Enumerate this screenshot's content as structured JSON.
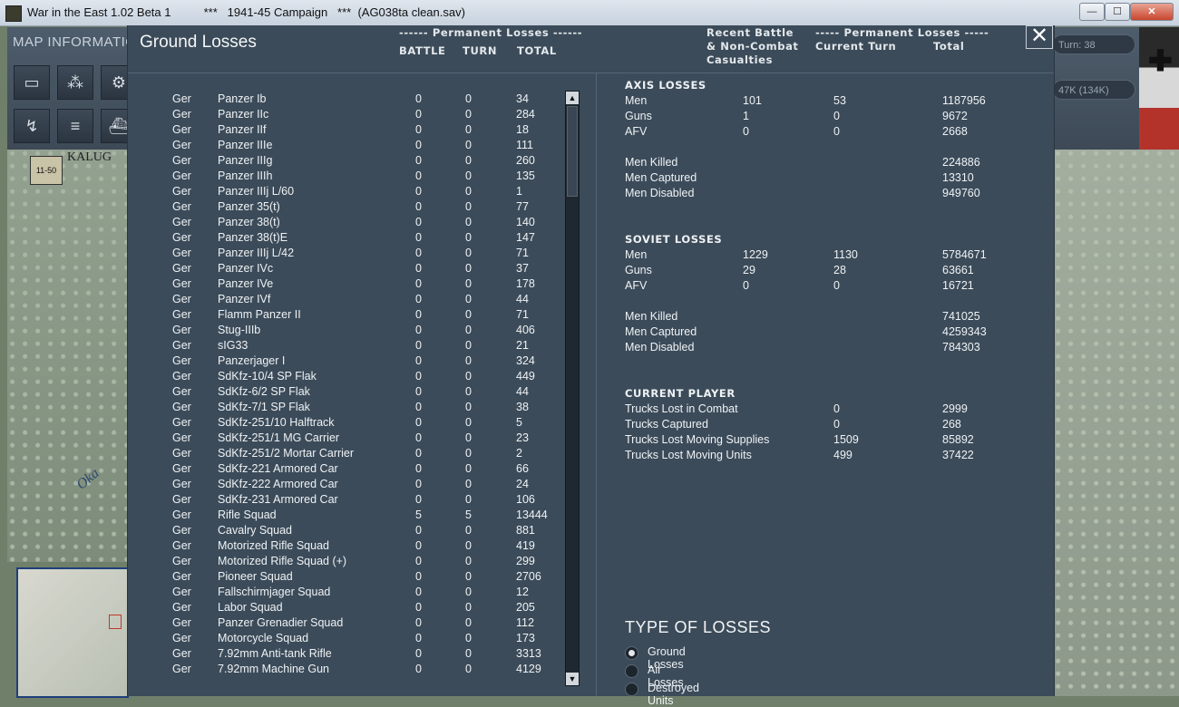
{
  "window": {
    "title": "War in the East 1.02 Beta 1          ***   1941-45 Campaign   ***  (AG038ta clean.sav)",
    "min_label": "—",
    "max_label": "☐",
    "close_label": "✕"
  },
  "background": {
    "map_info_label": "MAP INFORMATIO",
    "map_label_city": "KALUG",
    "map_label_river": "Oka",
    "counter_label": "11-50",
    "turn_pill": "Turn: 38",
    "loss_pill": "47K (134K)"
  },
  "dialog": {
    "title": "Ground Losses",
    "close_label": "✕",
    "header_perm_left": "------ Permanent Losses ------",
    "col_battle": "BATTLE",
    "col_turn": "TURN",
    "col_total": "TOTAL",
    "header_recent_1": "Recent Battle",
    "header_recent_2": "& Non-Combat",
    "header_recent_3": "Casualties",
    "header_perm_right": "----- Permanent Losses -----",
    "col_current_turn": "Current Turn",
    "col_total_right": "Total"
  },
  "equipment_rows": [
    {
      "nat": "Ger",
      "name": "Panzer Ib",
      "battle": "0",
      "turn": "0",
      "total": "34"
    },
    {
      "nat": "Ger",
      "name": "Panzer IIc",
      "battle": "0",
      "turn": "0",
      "total": "284"
    },
    {
      "nat": "Ger",
      "name": "Panzer IIf",
      "battle": "0",
      "turn": "0",
      "total": "18"
    },
    {
      "nat": "Ger",
      "name": "Panzer IIIe",
      "battle": "0",
      "turn": "0",
      "total": "111"
    },
    {
      "nat": "Ger",
      "name": "Panzer IIIg",
      "battle": "0",
      "turn": "0",
      "total": "260"
    },
    {
      "nat": "Ger",
      "name": "Panzer IIIh",
      "battle": "0",
      "turn": "0",
      "total": "135"
    },
    {
      "nat": "Ger",
      "name": "Panzer IIIj L/60",
      "battle": "0",
      "turn": "0",
      "total": "1"
    },
    {
      "nat": "Ger",
      "name": "Panzer 35(t)",
      "battle": "0",
      "turn": "0",
      "total": "77"
    },
    {
      "nat": "Ger",
      "name": "Panzer 38(t)",
      "battle": "0",
      "turn": "0",
      "total": "140"
    },
    {
      "nat": "Ger",
      "name": "Panzer 38(t)E",
      "battle": "0",
      "turn": "0",
      "total": "147"
    },
    {
      "nat": "Ger",
      "name": "Panzer IIIj L/42",
      "battle": "0",
      "turn": "0",
      "total": "71"
    },
    {
      "nat": "Ger",
      "name": "Panzer IVc",
      "battle": "0",
      "turn": "0",
      "total": "37"
    },
    {
      "nat": "Ger",
      "name": "Panzer IVe",
      "battle": "0",
      "turn": "0",
      "total": "178"
    },
    {
      "nat": "Ger",
      "name": "Panzer IVf",
      "battle": "0",
      "turn": "0",
      "total": "44"
    },
    {
      "nat": "Ger",
      "name": "Flamm Panzer II",
      "battle": "0",
      "turn": "0",
      "total": "71"
    },
    {
      "nat": "Ger",
      "name": "Stug-IIIb",
      "battle": "0",
      "turn": "0",
      "total": "406"
    },
    {
      "nat": "Ger",
      "name": "sIG33",
      "battle": "0",
      "turn": "0",
      "total": "21"
    },
    {
      "nat": "Ger",
      "name": "Panzerjager I",
      "battle": "0",
      "turn": "0",
      "total": "324"
    },
    {
      "nat": "Ger",
      "name": "SdKfz-10/4 SP Flak",
      "battle": "0",
      "turn": "0",
      "total": "449"
    },
    {
      "nat": "Ger",
      "name": "SdKfz-6/2 SP Flak",
      "battle": "0",
      "turn": "0",
      "total": "44"
    },
    {
      "nat": "Ger",
      "name": "SdKfz-7/1 SP Flak",
      "battle": "0",
      "turn": "0",
      "total": "38"
    },
    {
      "nat": "Ger",
      "name": "SdKfz-251/10 Halftrack",
      "battle": "0",
      "turn": "0",
      "total": "5"
    },
    {
      "nat": "Ger",
      "name": "SdKfz-251/1 MG Carrier",
      "battle": "0",
      "turn": "0",
      "total": "23"
    },
    {
      "nat": "Ger",
      "name": "SdKfz-251/2 Mortar Carrier",
      "battle": "0",
      "turn": "0",
      "total": "2"
    },
    {
      "nat": "Ger",
      "name": "SdKfz-221 Armored Car",
      "battle": "0",
      "turn": "0",
      "total": "66"
    },
    {
      "nat": "Ger",
      "name": "SdKfz-222 Armored Car",
      "battle": "0",
      "turn": "0",
      "total": "24"
    },
    {
      "nat": "Ger",
      "name": "SdKfz-231 Armored Car",
      "battle": "0",
      "turn": "0",
      "total": "106"
    },
    {
      "nat": "Ger",
      "name": "Rifle Squad",
      "battle": "5",
      "turn": "5",
      "total": "13444"
    },
    {
      "nat": "Ger",
      "name": "Cavalry Squad",
      "battle": "0",
      "turn": "0",
      "total": "881"
    },
    {
      "nat": "Ger",
      "name": "Motorized Rifle Squad",
      "battle": "0",
      "turn": "0",
      "total": "419"
    },
    {
      "nat": "Ger",
      "name": "Motorized Rifle Squad (+)",
      "battle": "0",
      "turn": "0",
      "total": "299"
    },
    {
      "nat": "Ger",
      "name": "Pioneer Squad",
      "battle": "0",
      "turn": "0",
      "total": "2706"
    },
    {
      "nat": "Ger",
      "name": "Fallschirmjager Squad",
      "battle": "0",
      "turn": "0",
      "total": "12"
    },
    {
      "nat": "Ger",
      "name": "Labor Squad",
      "battle": "0",
      "turn": "0",
      "total": "205"
    },
    {
      "nat": "Ger",
      "name": "Panzer Grenadier Squad",
      "battle": "0",
      "turn": "0",
      "total": "112"
    },
    {
      "nat": "Ger",
      "name": "Motorcycle Squad",
      "battle": "0",
      "turn": "0",
      "total": "173"
    },
    {
      "nat": "Ger",
      "name": "7.92mm Anti-tank Rifle",
      "battle": "0",
      "turn": "0",
      "total": "3313"
    },
    {
      "nat": "Ger",
      "name": "7.92mm Machine Gun",
      "battle": "0",
      "turn": "0",
      "total": "4129"
    }
  ],
  "axis": {
    "heading": "AXIS LOSSES",
    "rows": [
      {
        "label": "Men",
        "recent": "101",
        "turn": "53",
        "total": "1187956"
      },
      {
        "label": "Guns",
        "recent": "1",
        "turn": "0",
        "total": "9672"
      },
      {
        "label": "AFV",
        "recent": "0",
        "turn": "0",
        "total": "2668"
      }
    ],
    "breakdown": [
      {
        "label": "Men Killed",
        "total": "224886"
      },
      {
        "label": "Men Captured",
        "total": "13310"
      },
      {
        "label": "Men Disabled",
        "total": "949760"
      }
    ]
  },
  "soviet": {
    "heading": "SOVIET LOSSES",
    "rows": [
      {
        "label": "Men",
        "recent": "1229",
        "turn": "1130",
        "total": "5784671"
      },
      {
        "label": "Guns",
        "recent": "29",
        "turn": "28",
        "total": "63661"
      },
      {
        "label": "AFV",
        "recent": "0",
        "turn": "0",
        "total": "16721"
      }
    ],
    "breakdown": [
      {
        "label": "Men Killed",
        "total": "741025"
      },
      {
        "label": "Men Captured",
        "total": "4259343"
      },
      {
        "label": "Men Disabled",
        "total": "784303"
      }
    ]
  },
  "current_player": {
    "heading": "CURRENT PLAYER",
    "rows": [
      {
        "label": "Trucks Lost in Combat",
        "turn": "0",
        "total": "2999"
      },
      {
        "label": "Trucks Captured",
        "turn": "0",
        "total": "268"
      },
      {
        "label": "Trucks Lost Moving Supplies",
        "turn": "1509",
        "total": "85892"
      },
      {
        "label": "Trucks Lost Moving Units",
        "turn": "499",
        "total": "37422"
      }
    ]
  },
  "loss_types": {
    "title": "TYPE OF LOSSES",
    "options": [
      {
        "label": "Ground Losses",
        "selected": true
      },
      {
        "label": "Air Losses",
        "selected": false
      },
      {
        "label": "Destroyed Units",
        "selected": false
      }
    ]
  }
}
